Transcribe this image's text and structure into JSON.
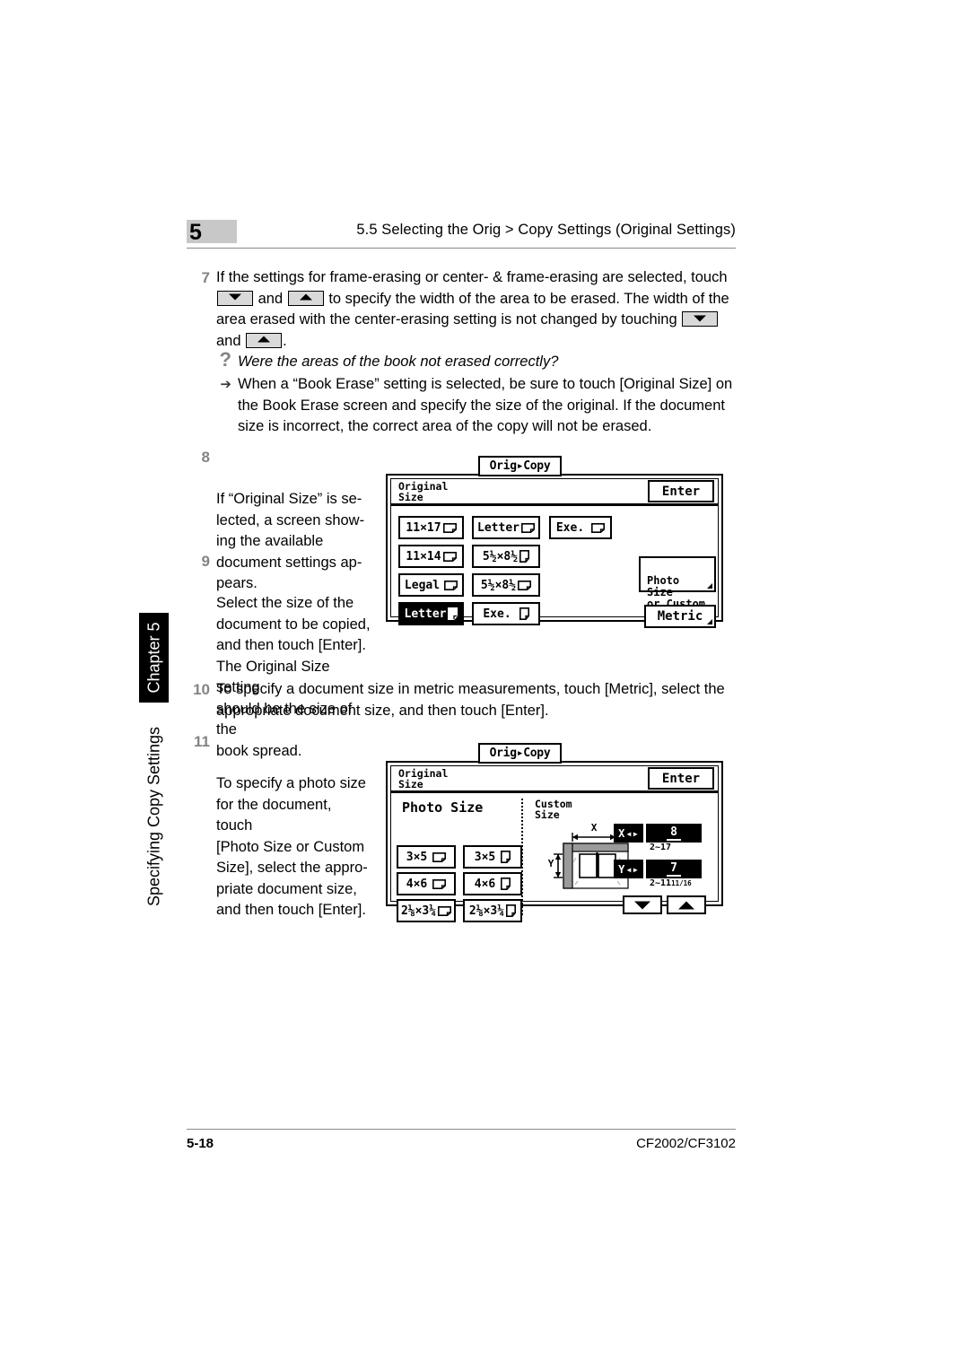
{
  "header": {
    "chapter_number": "5",
    "title": "5.5 Selecting the Orig > Copy Settings (Original Settings)"
  },
  "sidebar": {
    "chapter_tab": "Chapter 5",
    "section_label": "Specifying Copy Settings"
  },
  "steps": {
    "step7": {
      "number": "7",
      "text_a": "If the settings for frame-erasing or center- & frame-erasing are selected, touch",
      "text_b": "and",
      "text_c": "to specify the width of the area to be erased. The width of the area erased with the center-erasing setting is not changed by touching",
      "text_d": "and",
      "text_e": "."
    },
    "qa": {
      "question_mark": "?",
      "question": "Were the areas of the book not erased correctly?",
      "arrow": "➔",
      "answer": "When a “Book Erase” setting is selected, be sure to touch [Original Size] on the Book Erase screen and specify the size of the original. If the document size is incorrect, the correct area of the copy will not be erased."
    },
    "step8": {
      "number": "8",
      "text": "If “Original Size” is se-\nlected, a screen show-\ning the available\ndocument settings ap-\npears."
    },
    "step9": {
      "number": "9",
      "text": "Select the size of the\ndocument to be copied,\nand then touch [Enter].\nThe Original Size setting\nshould be the size of the\nbook spread."
    },
    "step10": {
      "number": "10",
      "text": "To specify a document size in metric measurements, touch [Metric], select the appropriate document size, and then touch [Enter]."
    },
    "step11": {
      "number": "11",
      "text": "To specify a photo size\nfor the document, touch\n[Photo Size or Custom\nSize], select the appro-\npriate document size,\nand then touch [Enter]."
    }
  },
  "screen1": {
    "tab_label": "Orig▸Copy",
    "title": "Original\nSize",
    "enter_label": "Enter",
    "size_buttons": [
      {
        "label": "11×17",
        "orientation": "landscape",
        "selected": false
      },
      {
        "label": "Letter",
        "orientation": "landscape",
        "selected": false
      },
      {
        "label": "Exe.",
        "orientation": "landscape",
        "selected": false
      },
      {
        "label": "11×14",
        "orientation": "landscape",
        "selected": false
      },
      {
        "label": "5½×8½",
        "orientation": "portrait",
        "selected": false
      },
      {
        "label": "Legal",
        "orientation": "landscape",
        "selected": false
      },
      {
        "label": "5½×8½",
        "orientation": "landscape",
        "selected": false
      },
      {
        "label": "Letter",
        "orientation": "portrait",
        "selected": true
      },
      {
        "label": "Exe.",
        "orientation": "portrait",
        "selected": false
      }
    ],
    "photo_custom_button": "Photo Size\nor Custom\nSize",
    "metric_button": "Metric"
  },
  "screen2": {
    "tab_label": "Orig▸Copy",
    "title": "Original\nSize",
    "enter_label": "Enter",
    "photo_size_label": "Photo Size",
    "custom_size_label": "Custom\nSize",
    "photo_buttons": [
      {
        "label": "3×5",
        "orientation": "landscape"
      },
      {
        "label": "3×5",
        "orientation": "portrait"
      },
      {
        "label": "4×6",
        "orientation": "landscape"
      },
      {
        "label": "4×6",
        "orientation": "portrait"
      },
      {
        "label": "2⅛×3¼",
        "orientation": "landscape"
      },
      {
        "label": "2⅛×3¼",
        "orientation": "portrait"
      }
    ],
    "diagram": {
      "x_label": "X",
      "y_label": "Y"
    },
    "custom_fields": [
      {
        "axis": "X",
        "value": "8",
        "range": "2~17",
        "range_small": ""
      },
      {
        "axis": "Y",
        "value": "7",
        "range": "2~11",
        "range_small": "11/16"
      }
    ]
  },
  "footer": {
    "page_number": "5-18",
    "model": "CF2002/CF3102"
  }
}
